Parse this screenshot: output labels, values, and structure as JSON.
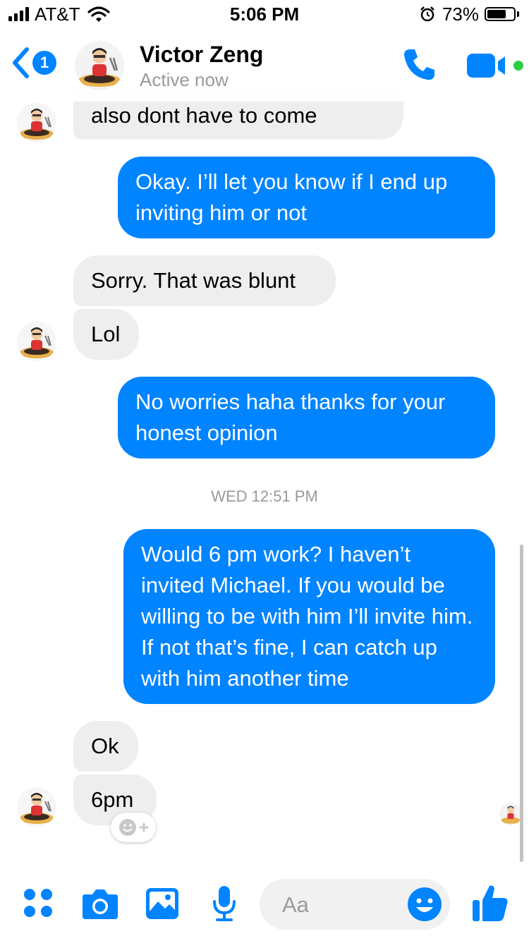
{
  "status_bar": {
    "carrier": "AT&T",
    "time": "5:06 PM",
    "battery": "73%",
    "battery_level": 0.73
  },
  "header": {
    "back_badge_count": "1",
    "contact_name": "Victor Zeng",
    "status": "Active now",
    "icons": [
      "back-chevron-icon",
      "phone-icon",
      "video-camera-icon"
    ]
  },
  "messages": [
    {
      "direction": "incoming",
      "text": "also dont have to come"
    },
    {
      "direction": "outgoing",
      "text": "Okay. I’ll let you know if I end up inviting him or not"
    },
    {
      "direction": "incoming",
      "text": "Sorry. That was blunt"
    },
    {
      "direction": "incoming",
      "text": "Lol"
    },
    {
      "direction": "outgoing",
      "text": "No worries haha thanks for your honest opinion"
    },
    {
      "direction": "outgoing",
      "text": "Would 6 pm work? I haven’t invited Michael. If you would be willing to be with him I’ll invite him. If not that’s fine, I can catch up with him another time"
    },
    {
      "direction": "incoming",
      "text": "Ok"
    },
    {
      "direction": "incoming",
      "text": "6pm"
    }
  ],
  "timestamp": "WED 12:51 PM",
  "composer": {
    "placeholder": "Aa",
    "icons": [
      "apps-icon",
      "camera-icon",
      "gallery-icon",
      "microphone-icon",
      "emoji-icon",
      "thumbs-up-icon"
    ]
  },
  "colors": {
    "accent": "#0084ff",
    "incoming_bubble": "#eeeeee",
    "active_green": "#2ecc40"
  }
}
